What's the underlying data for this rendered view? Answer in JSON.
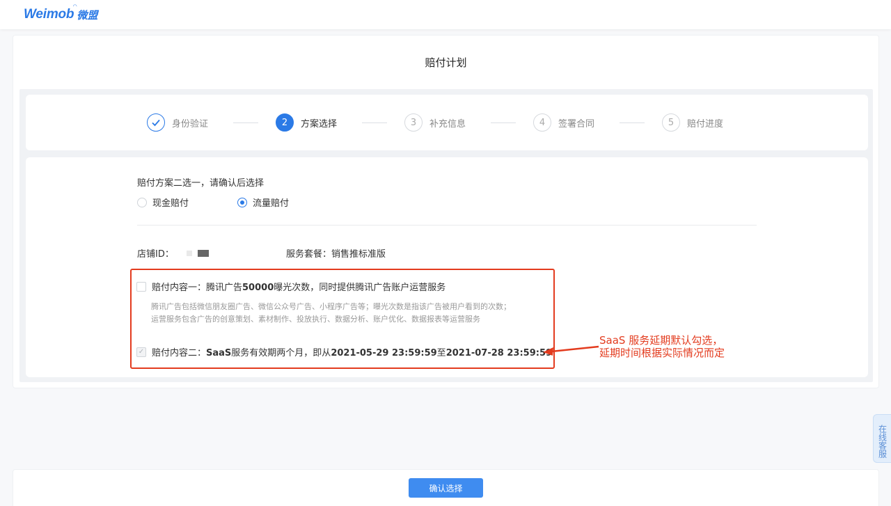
{
  "header": {
    "brand": "Weimob",
    "brand_cn": "微盟"
  },
  "page": {
    "title": "赔付计划"
  },
  "steps": [
    {
      "num": "",
      "label": "身份验证",
      "state": "done"
    },
    {
      "num": "2",
      "label": "方案选择",
      "state": "active"
    },
    {
      "num": "3",
      "label": "补充信息",
      "state": "pending"
    },
    {
      "num": "4",
      "label": "签署合同",
      "state": "pending"
    },
    {
      "num": "5",
      "label": "赔付进度",
      "state": "pending"
    }
  ],
  "plan": {
    "question": "赔付方案二选一，请确认后选择",
    "options": [
      {
        "label": "现金赔付",
        "checked": false
      },
      {
        "label": "流量赔付",
        "checked": true
      }
    ]
  },
  "store": {
    "id_label": "店铺ID：",
    "package_label": "服务套餐：销售推标准版"
  },
  "items": {
    "item1_prefix": "赔付内容一：腾讯广告",
    "item1_bold": "50000",
    "item1_suffix": "曝光次数，同时提供腾讯广告账户运营服务",
    "desc1": "腾讯广告包括微信朋友圈广告、微信公众号广告、小程序广告等；曝光次数是指该广告被用户看到的次数；",
    "desc2": "运营服务包含广告的创意策划、素材制作、投放执行、数据分析、账户优化、数据报表等运营服务",
    "item2_prefix": "赔付内容二：",
    "item2_bold1": "SaaS",
    "item2_mid": "服务有效期两个月，即从",
    "item2_bold2": "2021-05-29 23:59:59",
    "item2_mid2": "至",
    "item2_bold3": "2021-07-28 23:59:59"
  },
  "annotation": {
    "line1": "SaaS 服务延期默认勾选，",
    "line2": "延期时间根据实际情况而定"
  },
  "footer": {
    "confirm": "确认选择"
  },
  "service": {
    "label": "在线客服"
  },
  "colors": {
    "primary": "#2b7ae6",
    "annotation": "#e33b1e"
  }
}
